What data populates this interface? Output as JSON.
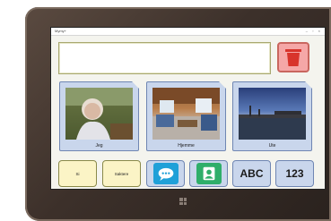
{
  "window": {
    "title": "Mymy+",
    "controls": "– ▫ ×"
  },
  "message_box": {
    "value": ""
  },
  "trash": {
    "icon": "trash-icon",
    "color": "#d8342c"
  },
  "categories": [
    {
      "label": "Jeg",
      "photo": "elderly-woman-portrait"
    },
    {
      "label": "Hjemme",
      "photo": "living-room-interior"
    },
    {
      "label": "Ute",
      "photo": "river-bridge-dusk"
    }
  ],
  "quick_buttons": {
    "si": "Si",
    "saktere": "Saktere",
    "abc": "ABC",
    "numbers": "123"
  },
  "icons": {
    "chat": "chat-bubble-icon",
    "contact": "contact-person-icon"
  },
  "colors": {
    "card": "#c9d6ec",
    "yellow_button": "#fbf4c6",
    "chat": "#1fa0d8",
    "contact": "#2fae6a"
  }
}
